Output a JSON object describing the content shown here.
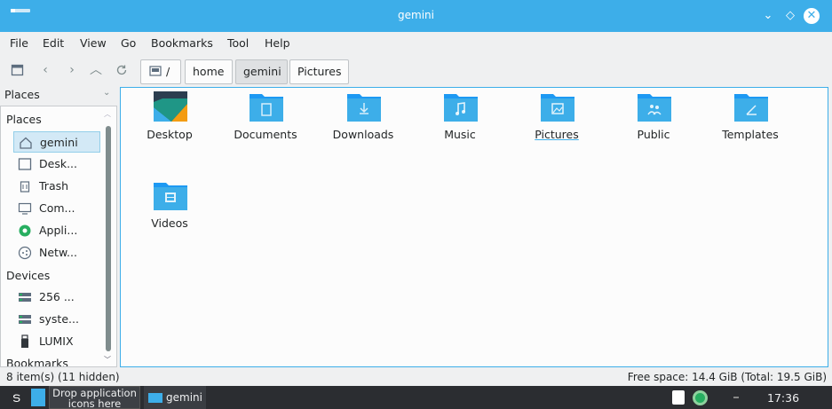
{
  "window": {
    "title": "gemini"
  },
  "menu": [
    "File",
    "Edit",
    "View",
    "Go",
    "Bookmarks",
    "Tool",
    "Help"
  ],
  "breadcrumb": {
    "root": "/",
    "items": [
      "home",
      "gemini",
      "Pictures"
    ],
    "active_index": 1
  },
  "sidebar": {
    "header": "Places",
    "sections": {
      "places": "Places",
      "devices": "Devices",
      "bookmarks": "Bookmarks"
    },
    "places_items": [
      "gemini",
      "Desk...",
      "Trash",
      "Com...",
      "Appli...",
      "Netw..."
    ],
    "device_items": [
      "256 ...",
      "syste...",
      "LUMIX"
    ]
  },
  "folders": [
    "Desktop",
    "Documents",
    "Downloads",
    "Music",
    "Pictures",
    "Public",
    "Templates",
    "Videos"
  ],
  "status": {
    "left": "8 item(s) (11 hidden)",
    "right": "Free space: 14.4 GiB (Total: 19.5 GiB)"
  },
  "taskbar": {
    "drop_hint": "Drop application icons here",
    "task_label": "gemini",
    "clock": "17:36"
  },
  "colors": {
    "accent": "#3daee9",
    "taskbar": "#2b2d31"
  }
}
